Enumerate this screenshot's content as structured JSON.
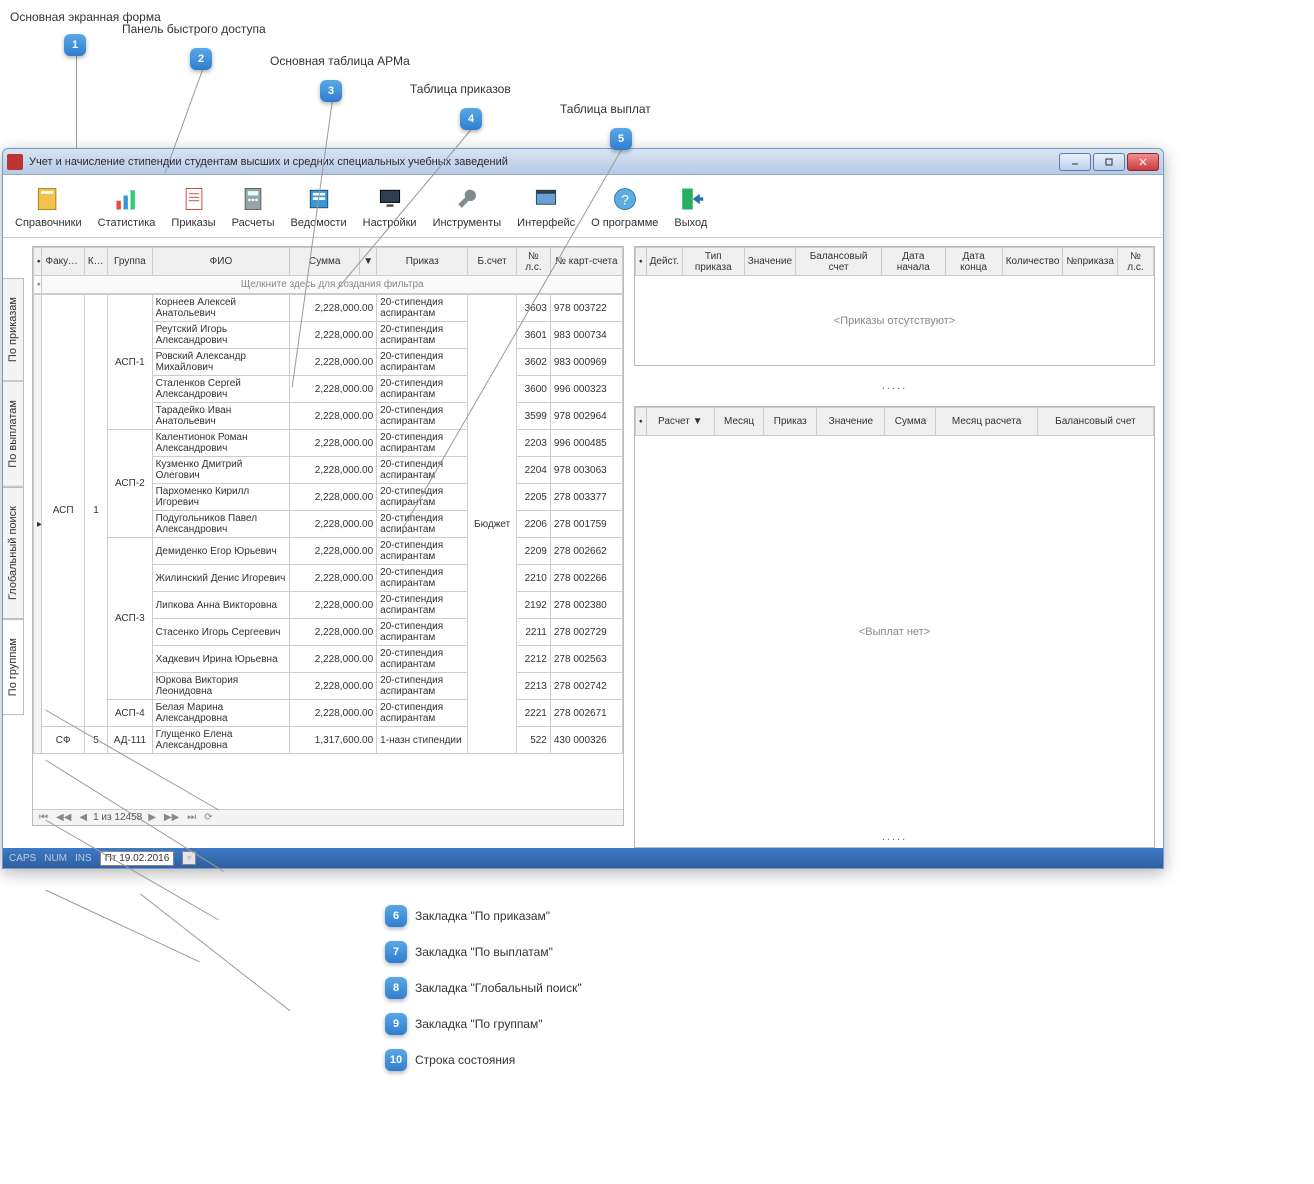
{
  "callouts_top": {
    "c1": "Основная экранная форма",
    "c2": "Панель быстрого доступа",
    "c3": "Основная таблица АРМа",
    "c4": "Таблица приказов",
    "c5": "Таблица выплат"
  },
  "callouts_bottom": {
    "c6": "Закладка \"По приказам\"",
    "c7": "Закладка \"По выплатам\"",
    "c8": "Закладка \"Глобальный поиск\"",
    "c9": "Закладка \"По группам\"",
    "c10": "Строка состояния"
  },
  "window": {
    "title": "Учет и начисление стипендии студентам высших и средних специальных учебных заведений"
  },
  "toolbar": {
    "items": [
      {
        "label": "Справочники"
      },
      {
        "label": "Статистика"
      },
      {
        "label": "Приказы"
      },
      {
        "label": "Расчеты"
      },
      {
        "label": "Ведомости"
      },
      {
        "label": "Настройки"
      },
      {
        "label": "Инструменты"
      },
      {
        "label": "Интерфейс"
      },
      {
        "label": "О программе"
      },
      {
        "label": "Выход"
      }
    ]
  },
  "vtabs": {
    "t1": "По приказам",
    "t2": "По выплатам",
    "t3": "Глобальный поиск",
    "t4": "По группам"
  },
  "main_table": {
    "headers": {
      "h1": "Факультет",
      "h2": "Курс",
      "h3": "Группа",
      "h4": "ФИО",
      "h5": "Сумма",
      "h6": "Приказ",
      "h7": "Б.счет",
      "h8": "№ л.с.",
      "h9": "№ карт-счета"
    },
    "filter_hint": "Щелкните здесь для создания фильтра",
    "faculty": "АСП",
    "course": "1",
    "budget": "Бюджет",
    "groups": {
      "g1": "АСП-1",
      "g2": "АСП-2",
      "g3": "АСП-3",
      "g4": "АСП-4",
      "g5": "АД-111"
    },
    "fac2": "СФ",
    "course2": "5",
    "rows": [
      {
        "fio": "Корнеев Алексей Анатольевич",
        "sum": "2,228,000.00",
        "order": "20-стипендия аспирантам",
        "ls": "3603",
        "card": "978 003722"
      },
      {
        "fio": "Реутский Игорь Александрович",
        "sum": "2,228,000.00",
        "order": "20-стипендия аспирантам",
        "ls": "3601",
        "card": "983 000734"
      },
      {
        "fio": "Ровский Александр Михайлович",
        "sum": "2,228,000.00",
        "order": "20-стипендия аспирантам",
        "ls": "3602",
        "card": "983 000969"
      },
      {
        "fio": "Сталенков Сергей Александрович",
        "sum": "2,228,000.00",
        "order": "20-стипендия аспирантам",
        "ls": "3600",
        "card": "996 000323"
      },
      {
        "fio": "Тарадейко Иван Анатольевич",
        "sum": "2,228,000.00",
        "order": "20-стипендия аспирантам",
        "ls": "3599",
        "card": "978 002964"
      },
      {
        "fio": "Калентионок Роман Александрович",
        "sum": "2,228,000.00",
        "order": "20-стипендия аспирантам",
        "ls": "2203",
        "card": "996 000485"
      },
      {
        "fio": "Кузменко Дмитрий Олегович",
        "sum": "2,228,000.00",
        "order": "20-стипендия аспирантам",
        "ls": "2204",
        "card": "978 003063"
      },
      {
        "fio": "Пархоменко Кирилл Игоревич",
        "sum": "2,228,000.00",
        "order": "20-стипендия аспирантам",
        "ls": "2205",
        "card": "278 003377"
      },
      {
        "fio": "Подугольников Павел Александрович",
        "sum": "2,228,000.00",
        "order": "20-стипендия аспирантам",
        "ls": "2206",
        "card": "278 001759"
      },
      {
        "fio": "Демиденко Егор Юрьевич",
        "sum": "2,228,000.00",
        "order": "20-стипендия аспирантам",
        "ls": "2209",
        "card": "278 002662"
      },
      {
        "fio": "Жилинский Денис Игоревич",
        "sum": "2,228,000.00",
        "order": "20-стипендия аспирантам",
        "ls": "2210",
        "card": "278 002266"
      },
      {
        "fio": "Липкова Анна Викторовна",
        "sum": "2,228,000.00",
        "order": "20-стипендия аспирантам",
        "ls": "2192",
        "card": "278 002380"
      },
      {
        "fio": "Стасенко Игорь Сергеевич",
        "sum": "2,228,000.00",
        "order": "20-стипендия аспирантам",
        "ls": "2211",
        "card": "278 002729"
      },
      {
        "fio": "Хадкевич Ирина Юрьевна",
        "sum": "2,228,000.00",
        "order": "20-стипендия аспирантам",
        "ls": "2212",
        "card": "278 002563"
      },
      {
        "fio": "Юркова Виктория Леонидовна",
        "sum": "2,228,000.00",
        "order": "20-стипендия аспирантам",
        "ls": "2213",
        "card": "278 002742"
      },
      {
        "fio": "Белая Марина Александровна",
        "sum": "2,228,000.00",
        "order": "20-стипендия аспирантам",
        "ls": "2221",
        "card": "278 002671"
      },
      {
        "fio": "Глущенко Елена Александровна",
        "sum": "1,317,600.00",
        "order": "1-назн стипендии",
        "ls": "522",
        "card": "430 000326"
      }
    ],
    "nav": "1 из 12458"
  },
  "orders_panel": {
    "headers": {
      "h0": "Дейст.",
      "h1": "Тип приказа",
      "h2": "Значение",
      "h3": "Балансовый счет",
      "h4": "Дата начала",
      "h5": "Дата конца",
      "h6": "Количество",
      "h7": "№приказа",
      "h8": "№ л.с."
    },
    "empty": "<Приказы отсутствуют>"
  },
  "payments_panel": {
    "headers": {
      "h1": "Расчет",
      "h2": "Месяц",
      "h3": "Приказ",
      "h4": "Значение",
      "h5": "Сумма",
      "h6": "Месяц расчета",
      "h7": "Балансовый счет"
    },
    "empty": "<Выплат нет>"
  },
  "statusbar": {
    "caps": "CAPS",
    "num": "NUM",
    "ins": "INS",
    "date": "Пт 19.02.2016"
  }
}
